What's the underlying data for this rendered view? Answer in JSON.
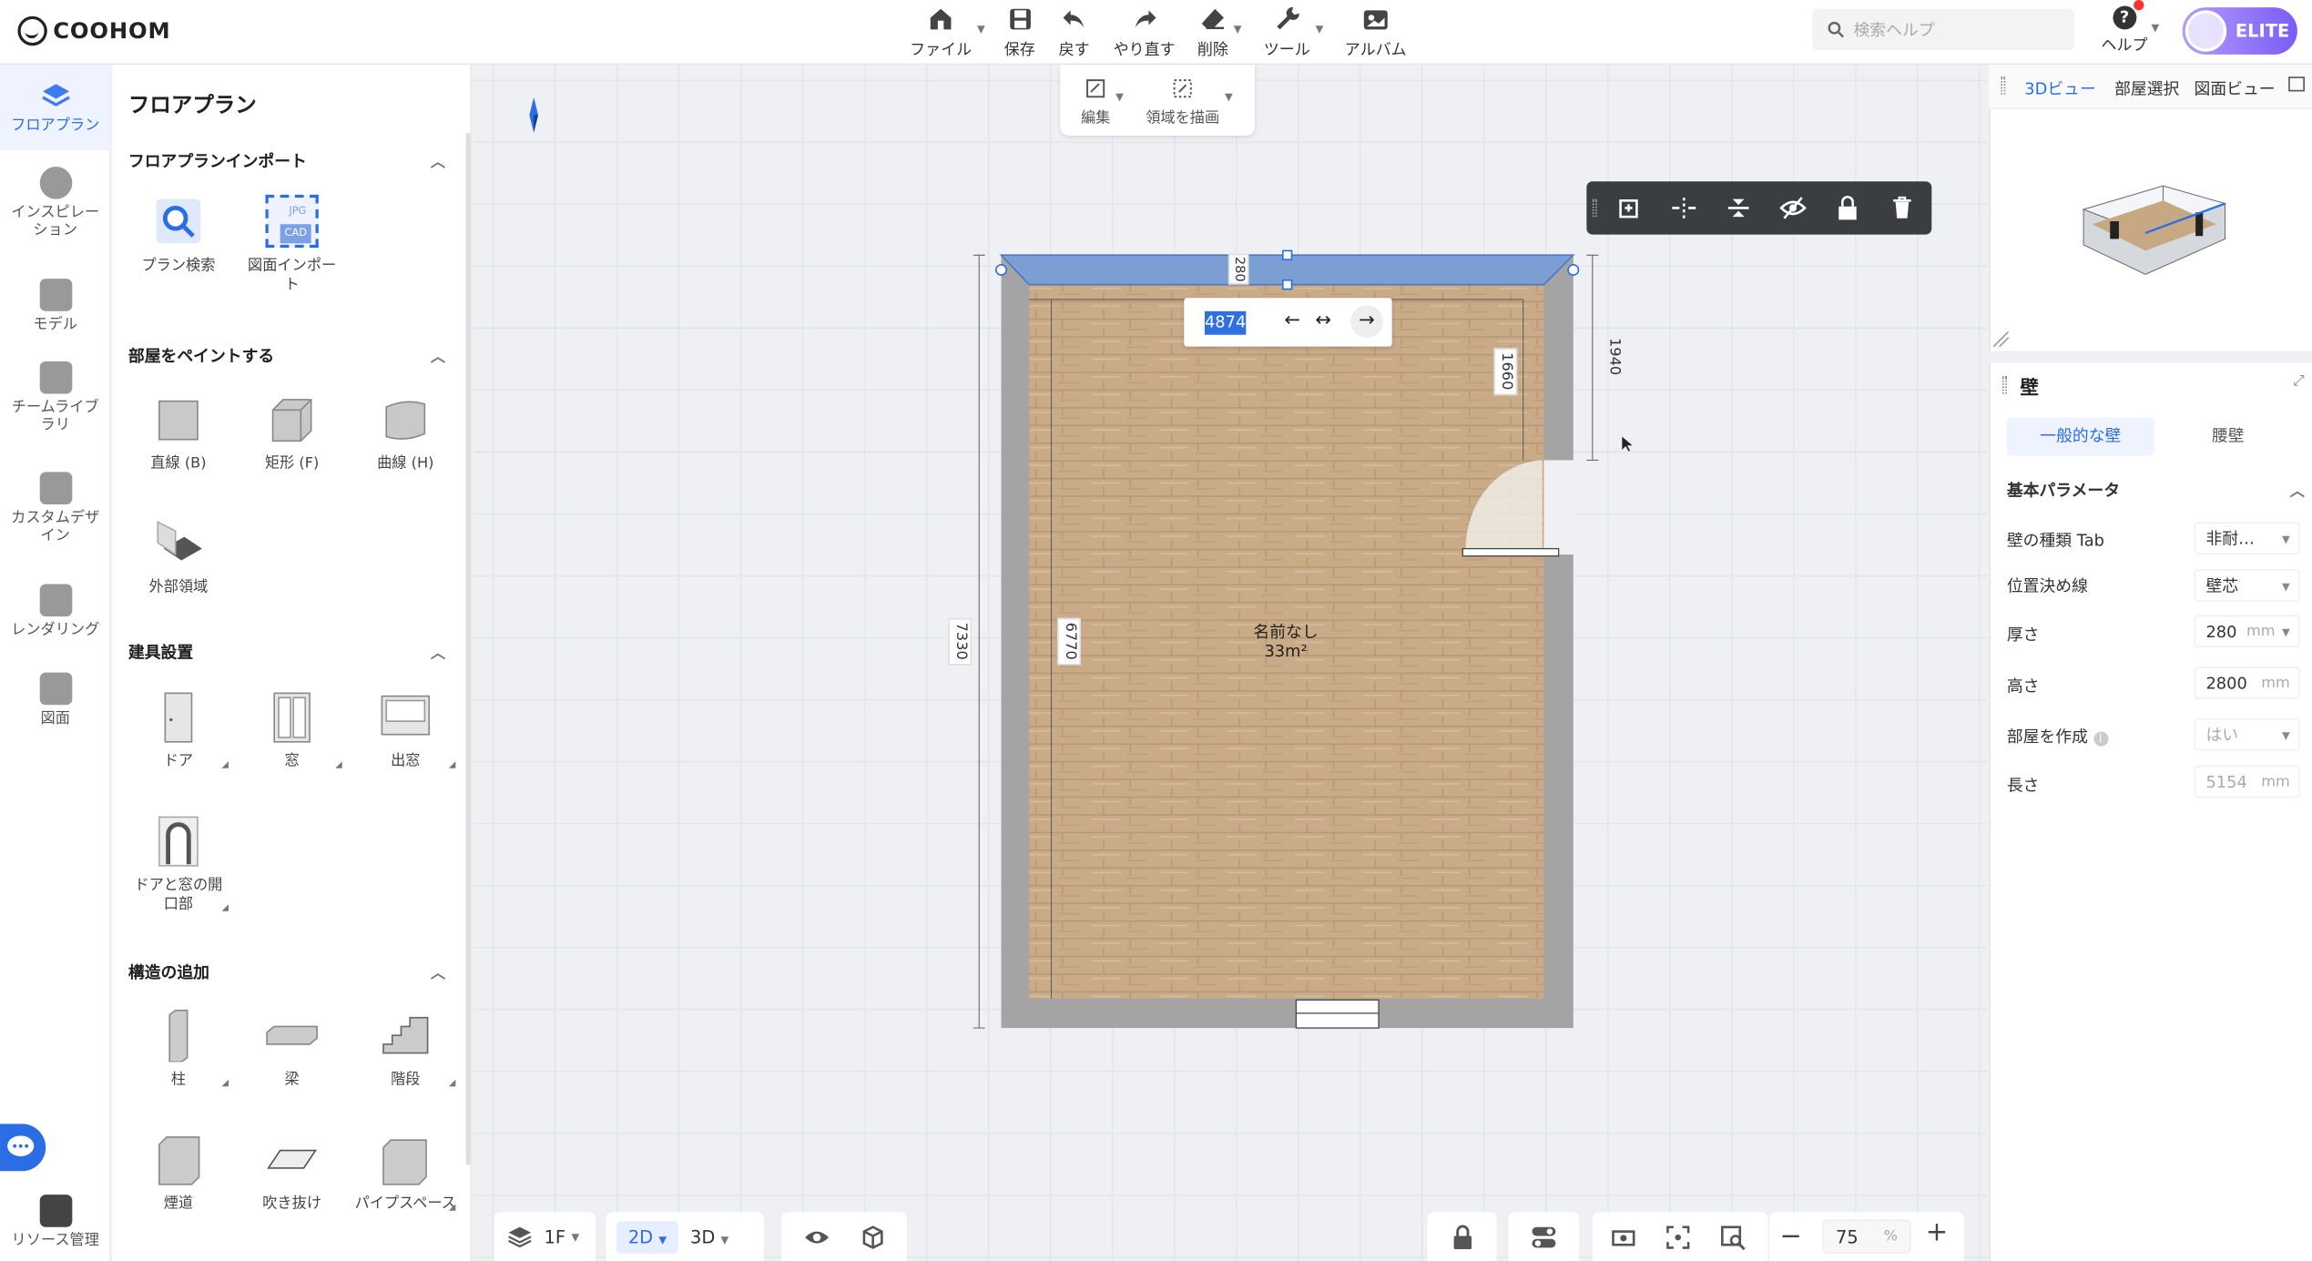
{
  "brand": {
    "name": "COOHOM"
  },
  "toolbar": {
    "file": "ファイル",
    "save": "保存",
    "undo": "戻す",
    "redo": "やり直す",
    "delete": "削除",
    "tools": "ツール",
    "album": "アルバム"
  },
  "search": {
    "placeholder": "検索ヘルプ"
  },
  "help": {
    "label": "ヘルプ"
  },
  "account": {
    "badge": "ELITE"
  },
  "rail": {
    "items": [
      {
        "label": "フロアプラン",
        "icon": "floorplan-icon",
        "active": true
      },
      {
        "label": "インスピレーション",
        "icon": "bulb-icon"
      },
      {
        "label": "モデル",
        "icon": "sofa-icon"
      },
      {
        "label": "チームライブラリ",
        "icon": "crown-icon"
      },
      {
        "label": "カスタムデザイン",
        "icon": "custom-design-icon"
      },
      {
        "label": "レンダリング",
        "icon": "camera-icon"
      },
      {
        "label": "図面",
        "icon": "drawing-icon"
      }
    ],
    "bottom": "リソース管理"
  },
  "panel": {
    "title": "フロアプラン",
    "sections": [
      {
        "title": "フロアプランインポート",
        "items": [
          "プラン検索",
          "図面インポート"
        ]
      },
      {
        "title": "部屋をペイントする",
        "items": [
          "直線 (B)",
          "矩形 (F)",
          "曲線 (H)",
          "外部領域"
        ]
      },
      {
        "title": "建具設置",
        "items": [
          "ドア",
          "窓",
          "出窓",
          "ドアと窓の開口部"
        ]
      },
      {
        "title": "構造の追加",
        "items": [
          "柱",
          "梁",
          "階段",
          "煙道",
          "吹き抜け",
          "パイプスペース"
        ]
      }
    ],
    "import_badges": {
      "jpg": "JPG",
      "cad": "CAD"
    }
  },
  "modebar": {
    "edit": "編集",
    "draw_area": "領域を描画"
  },
  "canvas": {
    "dim_input": "4874",
    "dims": {
      "top": "280",
      "right_inner": "1660",
      "right_outer": "1940",
      "left_outer": "7330",
      "left_inner": "6770"
    },
    "room_name": "名前なし",
    "room_area": "33m²"
  },
  "right": {
    "tabs": [
      "3Dビュー",
      "部屋選択",
      "図面ビュー"
    ],
    "section": "壁",
    "wall_tabs": [
      "一般的な壁",
      "腰壁"
    ],
    "group": "基本パラメータ",
    "props": [
      {
        "label": "壁の種類  Tab",
        "value": "非耐…"
      },
      {
        "label": "位置決め線",
        "value": "壁芯"
      },
      {
        "label": "厚さ",
        "value": "280",
        "unit": "mm"
      },
      {
        "label": "高さ",
        "value": "2800",
        "unit": "mm"
      },
      {
        "label": "部屋を作成",
        "value": "はい"
      },
      {
        "label": "長さ",
        "value": "5154",
        "unit": "mm"
      }
    ]
  },
  "bottom": {
    "floor": "1F",
    "view2d": "2D",
    "view3d": "3D",
    "zoom": "75",
    "zoom_unit": "%"
  },
  "colors": {
    "accent": "#2b6de5",
    "wall": "#a9a9a9",
    "selected_wall": "#7b9fd3",
    "floor": "#c8aa86"
  }
}
